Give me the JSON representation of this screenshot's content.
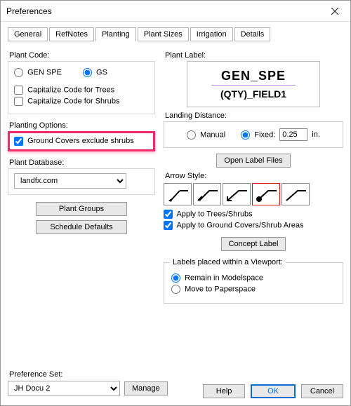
{
  "window": {
    "title": "Preferences"
  },
  "tabs": {
    "general": "General",
    "refnotes": "RefNotes",
    "planting": "Planting",
    "plant_sizes": "Plant Sizes",
    "irrigation": "Irrigation",
    "details": "Details"
  },
  "left": {
    "plant_code": {
      "label": "Plant Code:",
      "opt_gen_spe": "GEN SPE",
      "opt_gs": "GS",
      "cap_trees": "Capitalize Code for Trees",
      "cap_shrubs": "Capitalize Code for Shrubs"
    },
    "planting_options": {
      "label": "Planting Options:",
      "gc_exclude": "Ground Covers exclude shrubs"
    },
    "plant_database": {
      "label": "Plant Database:",
      "value": "landfx.com"
    },
    "buttons": {
      "plant_groups": "Plant Groups",
      "schedule_defaults": "Schedule Defaults"
    }
  },
  "right": {
    "plant_label": {
      "label": "Plant Label:",
      "preview_line1": "GEN_SPE",
      "preview_line2": "(QTY)_FIELD1"
    },
    "landing": {
      "label": "Landing Distance:",
      "manual": "Manual",
      "fixed": "Fixed:",
      "value": "0.25",
      "unit": "in."
    },
    "open_label_files": "Open Label Files",
    "arrow": {
      "label": "Arrow Style:",
      "apply_trees": "Apply to Trees/Shrubs",
      "apply_gc": "Apply to Ground Covers/Shrub Areas"
    },
    "concept_label": "Concept Label",
    "viewport": {
      "legend": "Labels placed within a Viewport:",
      "remain": "Remain in Modelspace",
      "move": "Move to Paperspace"
    }
  },
  "bottom": {
    "pref_set_label": "Preference Set:",
    "pref_set_value": "JH Docu 2",
    "manage": "Manage",
    "help": "Help",
    "ok": "OK",
    "cancel": "Cancel"
  }
}
